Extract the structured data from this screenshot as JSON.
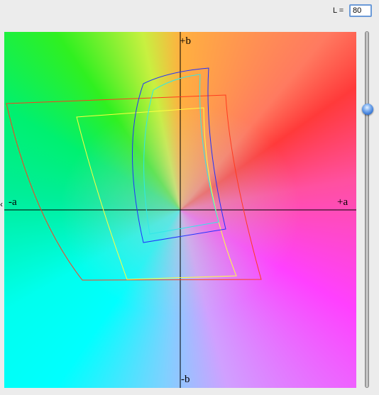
{
  "lightness": {
    "label": "L =",
    "value": "80"
  },
  "axes": {
    "pos_b": "+b",
    "neg_b": "-b",
    "pos_a": "+a",
    "neg_a": "-a"
  },
  "slider": {
    "level": 0.21
  },
  "gamut_outlines": [
    {
      "color": "#ff3b1f"
    },
    {
      "color": "#ffff40"
    },
    {
      "color": "#2030ff"
    },
    {
      "color": "#30e8e8"
    }
  ]
}
